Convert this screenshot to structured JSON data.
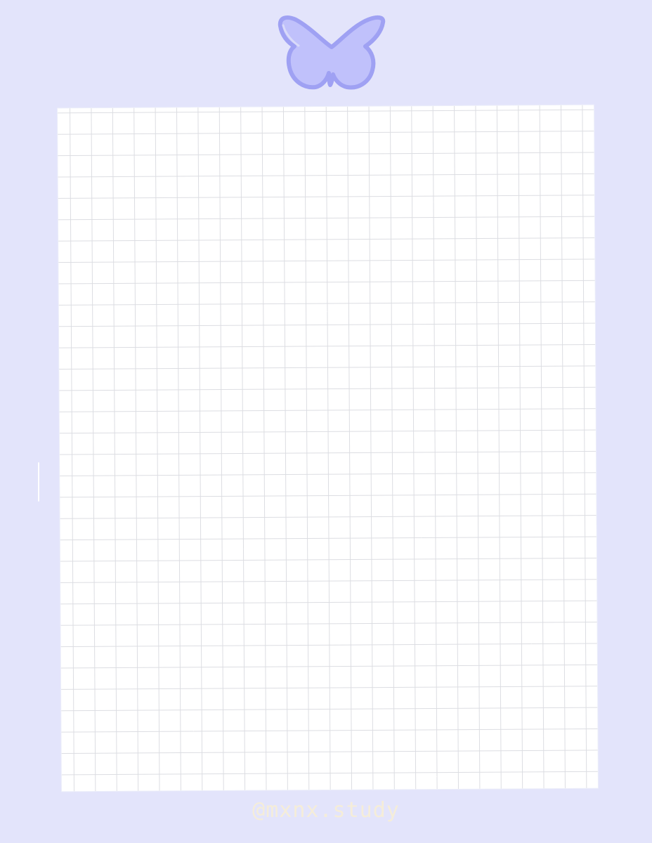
{
  "background": {
    "color": "#e3e4fb"
  },
  "decoration": {
    "icon": "butterfly-icon",
    "fill": "#c0c1fb",
    "outline": "#9fa1f3"
  },
  "sheet": {
    "style": "grid-paper",
    "paper_color": "#ffffff",
    "line_color": "#dcdde2"
  },
  "watermark": {
    "text": "@mxnx.study",
    "color": "#f7efd6"
  }
}
